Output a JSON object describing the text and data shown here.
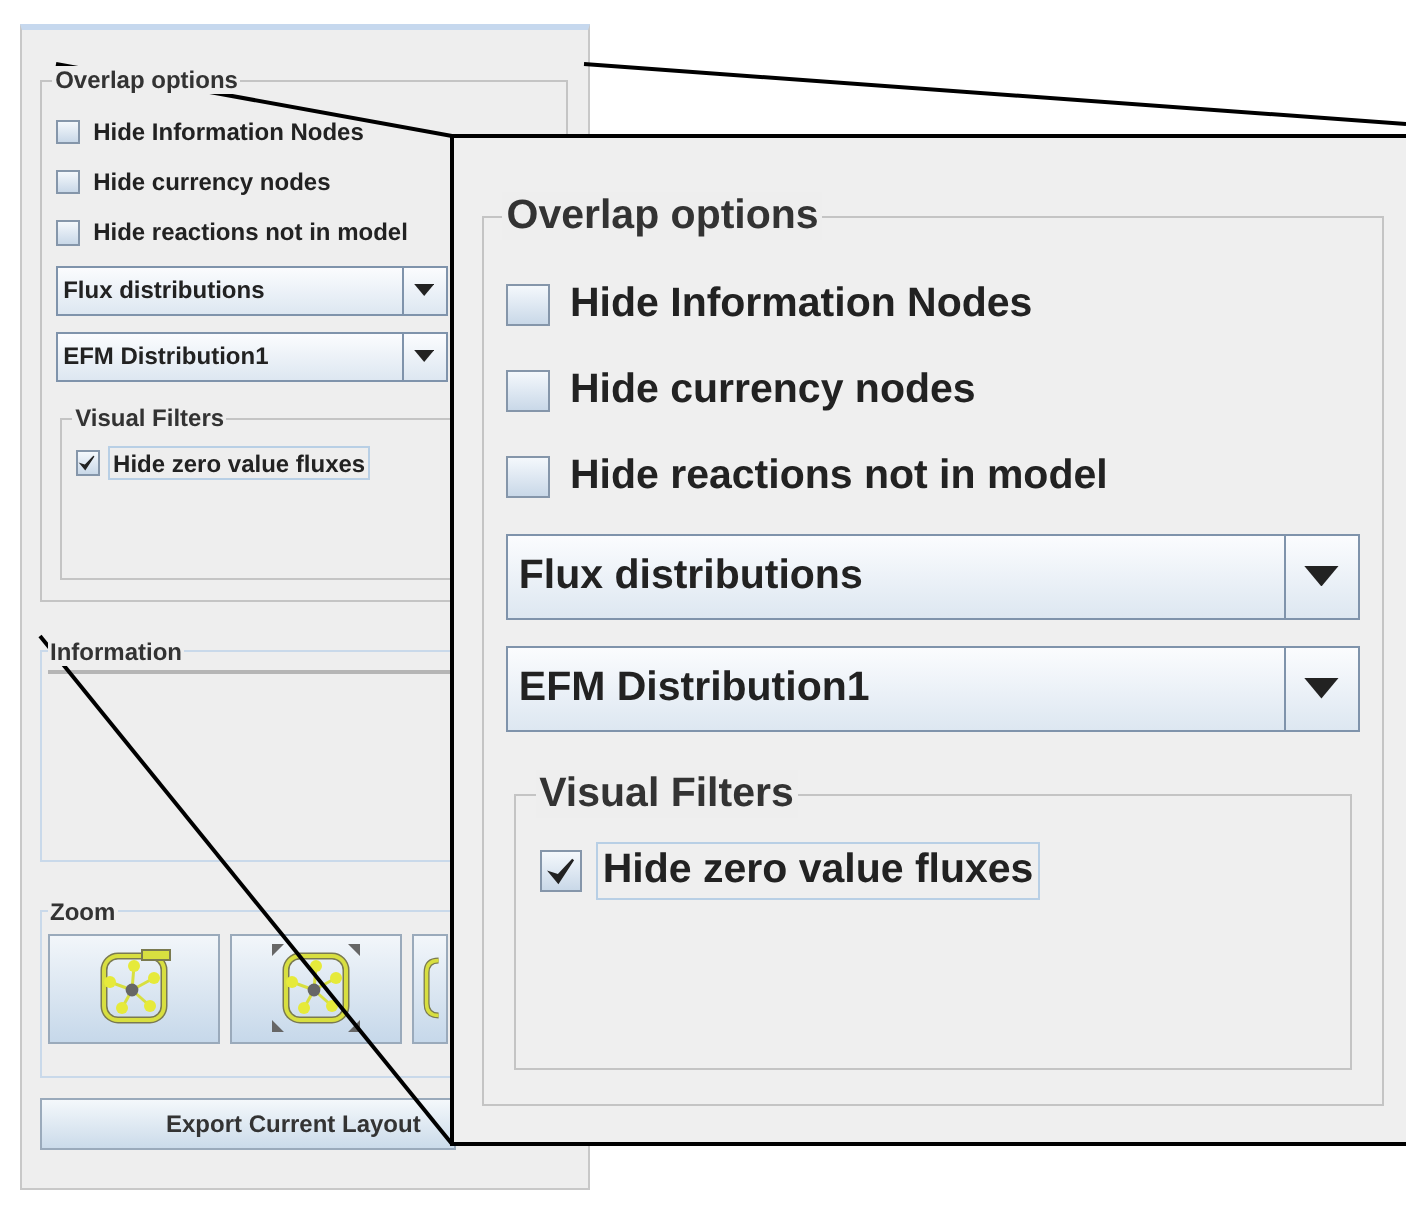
{
  "panel": {
    "overlap_options": {
      "title": "Overlap options",
      "checkboxes": [
        {
          "label": "Hide Information Nodes",
          "checked": false
        },
        {
          "label": "Hide currency nodes",
          "checked": false
        },
        {
          "label": "Hide reactions not in model",
          "checked": false
        }
      ],
      "dropdowns": [
        {
          "value": "Flux distributions"
        },
        {
          "value": "EFM Distribution1"
        }
      ],
      "visual_filters": {
        "title": "Visual Filters",
        "checkboxes": [
          {
            "label": "Hide zero value fluxes",
            "checked": true,
            "focused": true
          }
        ]
      }
    },
    "information": {
      "title": "Information"
    },
    "zoom": {
      "title": "Zoom",
      "buttons": [
        {
          "kind": "fit"
        },
        {
          "kind": "expand"
        },
        {
          "kind": "cut-off"
        }
      ]
    },
    "export_button": "Export Current Layout"
  },
  "magnified_view": {
    "overlap_options": {
      "title": "Overlap options",
      "checkboxes": [
        {
          "label": "Hide Information Nodes",
          "checked": false
        },
        {
          "label": "Hide currency nodes",
          "checked": false
        },
        {
          "label": "Hide reactions not in model",
          "checked": false
        }
      ],
      "dropdowns": [
        {
          "value": "Flux distributions"
        },
        {
          "value": "EFM Distribution1"
        }
      ],
      "visual_filters": {
        "title": "Visual Filters",
        "checkboxes": [
          {
            "label": "Hide zero value fluxes",
            "checked": true,
            "focused": true
          }
        ]
      }
    }
  }
}
